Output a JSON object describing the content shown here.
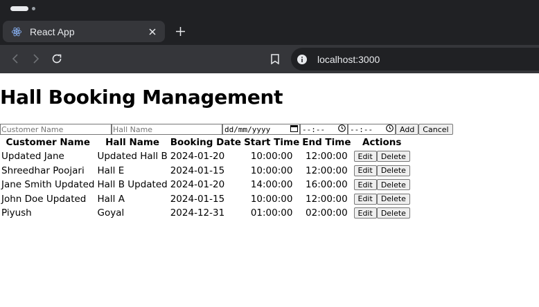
{
  "browser": {
    "tab_title": "React App",
    "url": "localhost:3000",
    "colors": {
      "frame": "#202124",
      "toolbar": "#35363a",
      "text": "#e8eaed"
    },
    "icons": [
      "react-icon",
      "close-icon",
      "plus-icon",
      "back-icon",
      "forward-icon",
      "reload-icon",
      "bookmark-icon",
      "info-icon"
    ]
  },
  "page": {
    "title": "Hall Booking Management",
    "form": {
      "customer_placeholder": "Customer Name",
      "hall_placeholder": "Hall Name",
      "date_placeholder": "dd/mm/yyyy",
      "start_placeholder": "--:-- ",
      "end_placeholder": "--:-- ",
      "add_label": "Add",
      "cancel_label": "Cancel"
    },
    "table": {
      "headers": [
        "Customer Name",
        "Hall Name",
        "Booking Date",
        "Start Time",
        "End Time",
        "Actions"
      ],
      "rows": [
        {
          "customer": "Updated Jane",
          "hall": "Updated Hall B",
          "date": "2024-01-20",
          "start": "10:00:00",
          "end": "12:00:00"
        },
        {
          "customer": "Shreedhar Poojari",
          "hall": "Hall E",
          "date": "2024-01-15",
          "start": "10:00:00",
          "end": "12:00:00"
        },
        {
          "customer": "Jane Smith Updated",
          "hall": "Hall B Updated",
          "date": "2024-01-20",
          "start": "14:00:00",
          "end": "16:00:00"
        },
        {
          "customer": "John Doe Updated",
          "hall": "Hall A",
          "date": "2024-01-15",
          "start": "10:00:00",
          "end": "12:00:00"
        },
        {
          "customer": "Piyush",
          "hall": "Goyal",
          "date": "2024-12-31",
          "start": "01:00:00",
          "end": "02:00:00"
        }
      ],
      "edit_label": "Edit",
      "delete_label": "Delete"
    }
  }
}
